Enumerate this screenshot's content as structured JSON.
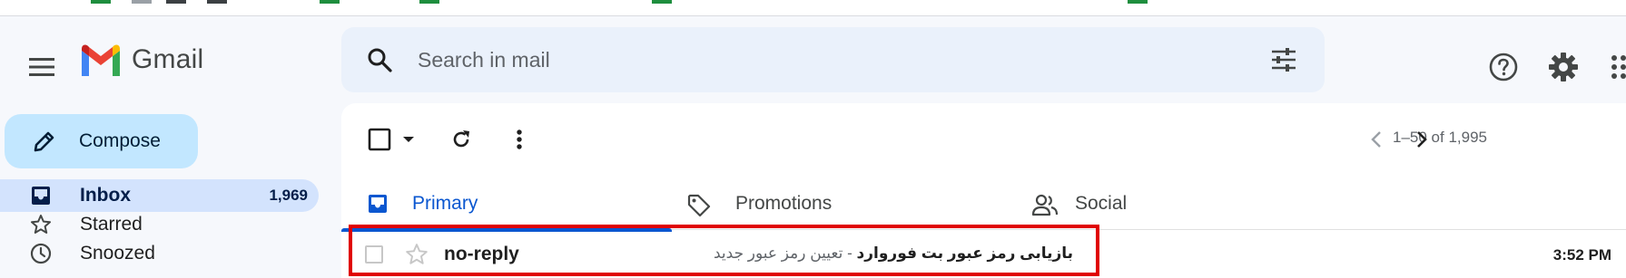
{
  "app": {
    "name": "Gmail"
  },
  "header": {
    "search_placeholder": "Search in mail",
    "icons": [
      "menu-icon",
      "search-icon",
      "filter-options-icon",
      "help-icon",
      "settings-icon",
      "apps-icon"
    ]
  },
  "sidebar": {
    "compose_label": "Compose",
    "items": [
      {
        "label": "Inbox",
        "count": "1,969",
        "icon": "inbox-icon",
        "active": true
      },
      {
        "label": "Starred",
        "count": "",
        "icon": "star-icon",
        "active": false
      },
      {
        "label": "Snoozed",
        "count": "",
        "icon": "clock-icon",
        "active": false
      }
    ]
  },
  "toolbar": {
    "pagination": "1–50 of 1,995",
    "icons": [
      "select-all-checkbox",
      "select-dropdown-icon",
      "refresh-icon",
      "more-options-icon",
      "prev-page-icon",
      "next-page-icon"
    ]
  },
  "tabs": [
    {
      "label": "Primary",
      "icon": "inbox-tab-icon",
      "active": true
    },
    {
      "label": "Promotions",
      "icon": "tag-icon",
      "active": false
    },
    {
      "label": "Social",
      "icon": "people-icon",
      "active": false
    }
  ],
  "emails": [
    {
      "sender": "no-reply",
      "subject": "بازیابی رمز عبور بت فوروارد",
      "separator": "-",
      "snippet": "تعیین رمز عبور جدید",
      "time": "3:52 PM",
      "unread": true
    }
  ],
  "colors": {
    "accent": "#0b57d0",
    "compose_bg": "#c2e7ff",
    "active_nav_bg": "#d3e3fd",
    "search_bg": "#eaf1fb",
    "highlight": "#e00000"
  }
}
